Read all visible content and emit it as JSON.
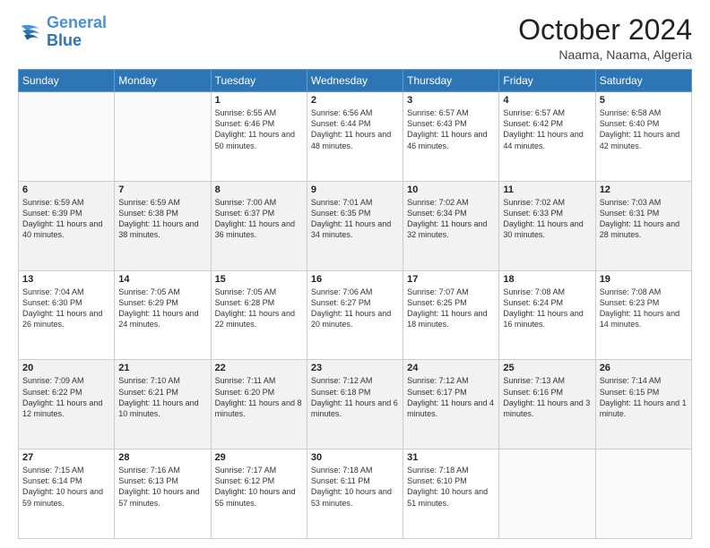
{
  "logo": {
    "line1": "General",
    "line2": "Blue"
  },
  "header": {
    "month": "October 2024",
    "location": "Naama, Naama, Algeria"
  },
  "days_of_week": [
    "Sunday",
    "Monday",
    "Tuesday",
    "Wednesday",
    "Thursday",
    "Friday",
    "Saturday"
  ],
  "weeks": [
    [
      {
        "day": "",
        "info": ""
      },
      {
        "day": "",
        "info": ""
      },
      {
        "day": "1",
        "info": "Sunrise: 6:55 AM\nSunset: 6:46 PM\nDaylight: 11 hours and 50 minutes."
      },
      {
        "day": "2",
        "info": "Sunrise: 6:56 AM\nSunset: 6:44 PM\nDaylight: 11 hours and 48 minutes."
      },
      {
        "day": "3",
        "info": "Sunrise: 6:57 AM\nSunset: 6:43 PM\nDaylight: 11 hours and 46 minutes."
      },
      {
        "day": "4",
        "info": "Sunrise: 6:57 AM\nSunset: 6:42 PM\nDaylight: 11 hours and 44 minutes."
      },
      {
        "day": "5",
        "info": "Sunrise: 6:58 AM\nSunset: 6:40 PM\nDaylight: 11 hours and 42 minutes."
      }
    ],
    [
      {
        "day": "6",
        "info": "Sunrise: 6:59 AM\nSunset: 6:39 PM\nDaylight: 11 hours and 40 minutes."
      },
      {
        "day": "7",
        "info": "Sunrise: 6:59 AM\nSunset: 6:38 PM\nDaylight: 11 hours and 38 minutes."
      },
      {
        "day": "8",
        "info": "Sunrise: 7:00 AM\nSunset: 6:37 PM\nDaylight: 11 hours and 36 minutes."
      },
      {
        "day": "9",
        "info": "Sunrise: 7:01 AM\nSunset: 6:35 PM\nDaylight: 11 hours and 34 minutes."
      },
      {
        "day": "10",
        "info": "Sunrise: 7:02 AM\nSunset: 6:34 PM\nDaylight: 11 hours and 32 minutes."
      },
      {
        "day": "11",
        "info": "Sunrise: 7:02 AM\nSunset: 6:33 PM\nDaylight: 11 hours and 30 minutes."
      },
      {
        "day": "12",
        "info": "Sunrise: 7:03 AM\nSunset: 6:31 PM\nDaylight: 11 hours and 28 minutes."
      }
    ],
    [
      {
        "day": "13",
        "info": "Sunrise: 7:04 AM\nSunset: 6:30 PM\nDaylight: 11 hours and 26 minutes."
      },
      {
        "day": "14",
        "info": "Sunrise: 7:05 AM\nSunset: 6:29 PM\nDaylight: 11 hours and 24 minutes."
      },
      {
        "day": "15",
        "info": "Sunrise: 7:05 AM\nSunset: 6:28 PM\nDaylight: 11 hours and 22 minutes."
      },
      {
        "day": "16",
        "info": "Sunrise: 7:06 AM\nSunset: 6:27 PM\nDaylight: 11 hours and 20 minutes."
      },
      {
        "day": "17",
        "info": "Sunrise: 7:07 AM\nSunset: 6:25 PM\nDaylight: 11 hours and 18 minutes."
      },
      {
        "day": "18",
        "info": "Sunrise: 7:08 AM\nSunset: 6:24 PM\nDaylight: 11 hours and 16 minutes."
      },
      {
        "day": "19",
        "info": "Sunrise: 7:08 AM\nSunset: 6:23 PM\nDaylight: 11 hours and 14 minutes."
      }
    ],
    [
      {
        "day": "20",
        "info": "Sunrise: 7:09 AM\nSunset: 6:22 PM\nDaylight: 11 hours and 12 minutes."
      },
      {
        "day": "21",
        "info": "Sunrise: 7:10 AM\nSunset: 6:21 PM\nDaylight: 11 hours and 10 minutes."
      },
      {
        "day": "22",
        "info": "Sunrise: 7:11 AM\nSunset: 6:20 PM\nDaylight: 11 hours and 8 minutes."
      },
      {
        "day": "23",
        "info": "Sunrise: 7:12 AM\nSunset: 6:18 PM\nDaylight: 11 hours and 6 minutes."
      },
      {
        "day": "24",
        "info": "Sunrise: 7:12 AM\nSunset: 6:17 PM\nDaylight: 11 hours and 4 minutes."
      },
      {
        "day": "25",
        "info": "Sunrise: 7:13 AM\nSunset: 6:16 PM\nDaylight: 11 hours and 3 minutes."
      },
      {
        "day": "26",
        "info": "Sunrise: 7:14 AM\nSunset: 6:15 PM\nDaylight: 11 hours and 1 minute."
      }
    ],
    [
      {
        "day": "27",
        "info": "Sunrise: 7:15 AM\nSunset: 6:14 PM\nDaylight: 10 hours and 59 minutes."
      },
      {
        "day": "28",
        "info": "Sunrise: 7:16 AM\nSunset: 6:13 PM\nDaylight: 10 hours and 57 minutes."
      },
      {
        "day": "29",
        "info": "Sunrise: 7:17 AM\nSunset: 6:12 PM\nDaylight: 10 hours and 55 minutes."
      },
      {
        "day": "30",
        "info": "Sunrise: 7:18 AM\nSunset: 6:11 PM\nDaylight: 10 hours and 53 minutes."
      },
      {
        "day": "31",
        "info": "Sunrise: 7:18 AM\nSunset: 6:10 PM\nDaylight: 10 hours and 51 minutes."
      },
      {
        "day": "",
        "info": ""
      },
      {
        "day": "",
        "info": ""
      }
    ]
  ]
}
